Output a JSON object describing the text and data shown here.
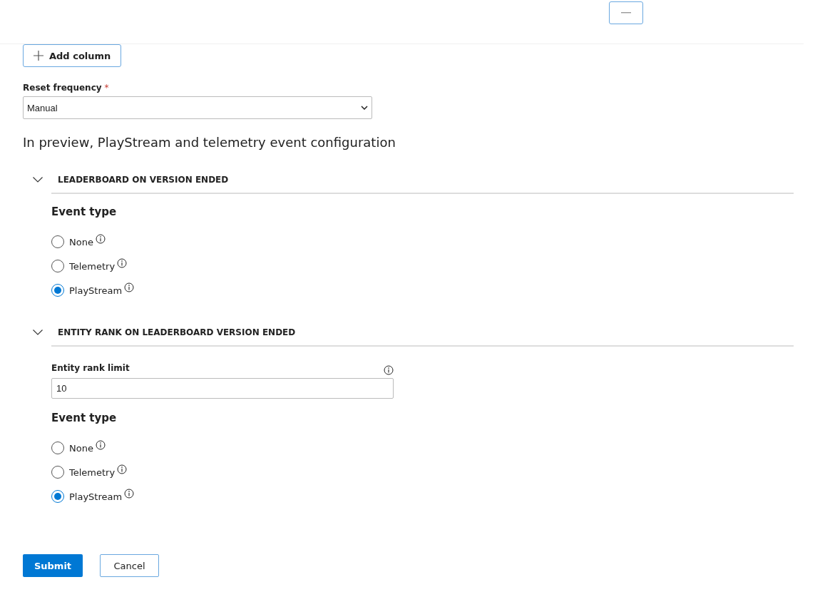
{
  "add_column_button": {
    "label": "Add column"
  },
  "reset_frequency": {
    "label": "Reset frequency",
    "required_mark": "*",
    "value": "Manual"
  },
  "heading": "In preview, PlayStream and telemetry event configuration",
  "sections": [
    {
      "title": "LEADERBOARD ON VERSION ENDED",
      "expanded": true,
      "event_type_label": "Event type",
      "options": [
        {
          "label": "None",
          "selected": false
        },
        {
          "label": "Telemetry",
          "selected": false
        },
        {
          "label": "PlayStream",
          "selected": true
        }
      ]
    },
    {
      "title": "ENTITY RANK ON LEADERBOARD VERSION ENDED",
      "expanded": true,
      "field": {
        "label": "Entity rank limit",
        "value": "10"
      },
      "event_type_label": "Event type",
      "options": [
        {
          "label": "None",
          "selected": false
        },
        {
          "label": "Telemetry",
          "selected": false
        },
        {
          "label": "PlayStream",
          "selected": true
        }
      ]
    }
  ],
  "buttons": [
    {
      "label": "Submit",
      "kind": "primary"
    },
    {
      "label": "Cancel",
      "kind": "secondary"
    }
  ]
}
